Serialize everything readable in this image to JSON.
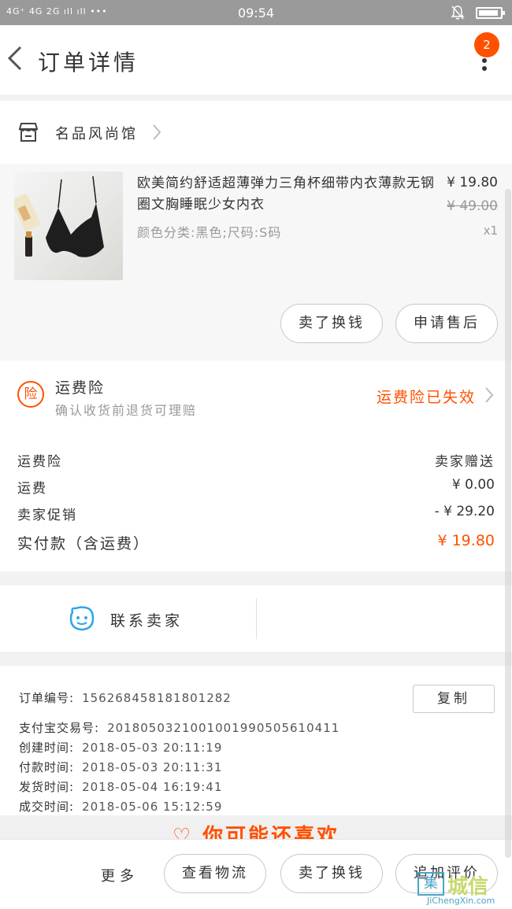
{
  "status_bar": {
    "signal_text": "4G⁺ 4G 2G ıll ıll •••",
    "time": "09:54"
  },
  "nav": {
    "title": "订单详情",
    "badge_count": "2"
  },
  "shop": {
    "name": "名品风尚馆"
  },
  "product": {
    "title": "欧美简约舒适超薄弹力三角杯细带内衣薄款无钢圈文胸睡眠少女内衣",
    "sku": "颜色分类:黑色;尺码:S码",
    "price": "¥ 19.80",
    "original_price": "¥ 49.00",
    "quantity": "x1",
    "resell_label": "卖了换钱",
    "aftersale_label": "申请售后"
  },
  "insurance": {
    "icon_text": "险",
    "title": "运费险",
    "subtitle": "确认收货前退货可理赔",
    "status": "运费险已失效"
  },
  "fees": {
    "rows": [
      {
        "label": "运费险",
        "value": "卖家赠送"
      },
      {
        "label": "运费",
        "value": "¥ 0.00"
      },
      {
        "label": "卖家促销",
        "value": "- ¥ 29.20"
      }
    ],
    "total_label": "实付款（含运费）",
    "total_value": "¥ 19.80"
  },
  "contact": {
    "label": "联系卖家"
  },
  "order_info": {
    "order_no_label": "订单编号:",
    "order_no": "156268458181801282",
    "copy_label": "复制",
    "rows": [
      {
        "label": "支付宝交易号:",
        "value": "2018050321001001990505610411"
      },
      {
        "label": "创建时间:",
        "value": "2018-05-03 20:11:19"
      },
      {
        "label": "付款时间:",
        "value": "2018-05-03 20:11:31"
      },
      {
        "label": "发货时间:",
        "value": "2018-05-04 16:19:41"
      },
      {
        "label": "成交时间:",
        "value": "2018-05-06 15:12:59"
      }
    ]
  },
  "recommend": {
    "text": "♡ 你可能还喜欢"
  },
  "bottom_bar": {
    "more_label": "更多",
    "logistics_label": "查看物流",
    "resell_label": "卖了换钱",
    "review_label": "追加评价"
  },
  "watermark": {
    "box_text": "集",
    "text": "城信",
    "sub": "JiChengXin.com"
  },
  "colors": {
    "accent": "#ff5000",
    "chat": "#2aa7e8"
  }
}
